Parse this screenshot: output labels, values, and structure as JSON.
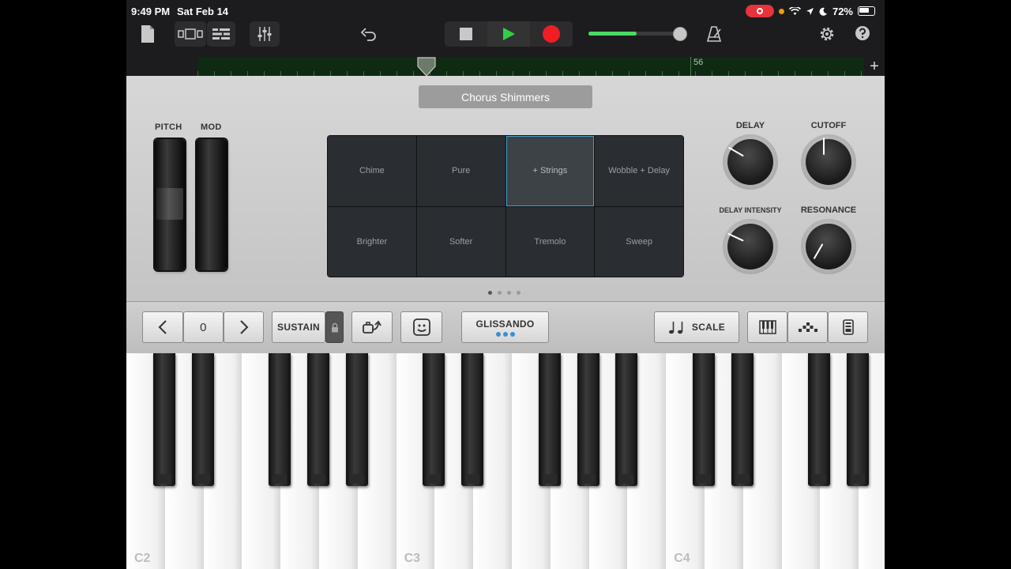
{
  "status_bar": {
    "time": "9:49 PM",
    "date": "Sat Feb 14",
    "battery": "72%"
  },
  "toolbar": {
    "volume_level": 0.55
  },
  "ruler": {
    "bar_label": "56"
  },
  "instrument": {
    "patch_name": "Chorus Shimmers",
    "wheels": {
      "pitch_label": "PITCH",
      "mod_label": "MOD"
    },
    "grid": [
      "Chime",
      "Pure",
      "+ Strings",
      "Wobble + Delay",
      "Brighter",
      "Softer",
      "Tremolo",
      "Sweep"
    ],
    "selected_cell": 2,
    "knobs": [
      {
        "label": "DELAY",
        "rotation": -60
      },
      {
        "label": "CUTOFF",
        "rotation": 0
      },
      {
        "label": "DELAY INTENSITY",
        "rotation": -65
      },
      {
        "label": "RESONANCE",
        "rotation": -150
      }
    ]
  },
  "controls": {
    "octave_value": "0",
    "sustain_label": "SUSTAIN",
    "glissando_label": "GLISSANDO",
    "scale_label": "SCALE"
  },
  "keyboard": {
    "octave_labels": [
      "C2",
      "C3",
      "C4"
    ]
  }
}
